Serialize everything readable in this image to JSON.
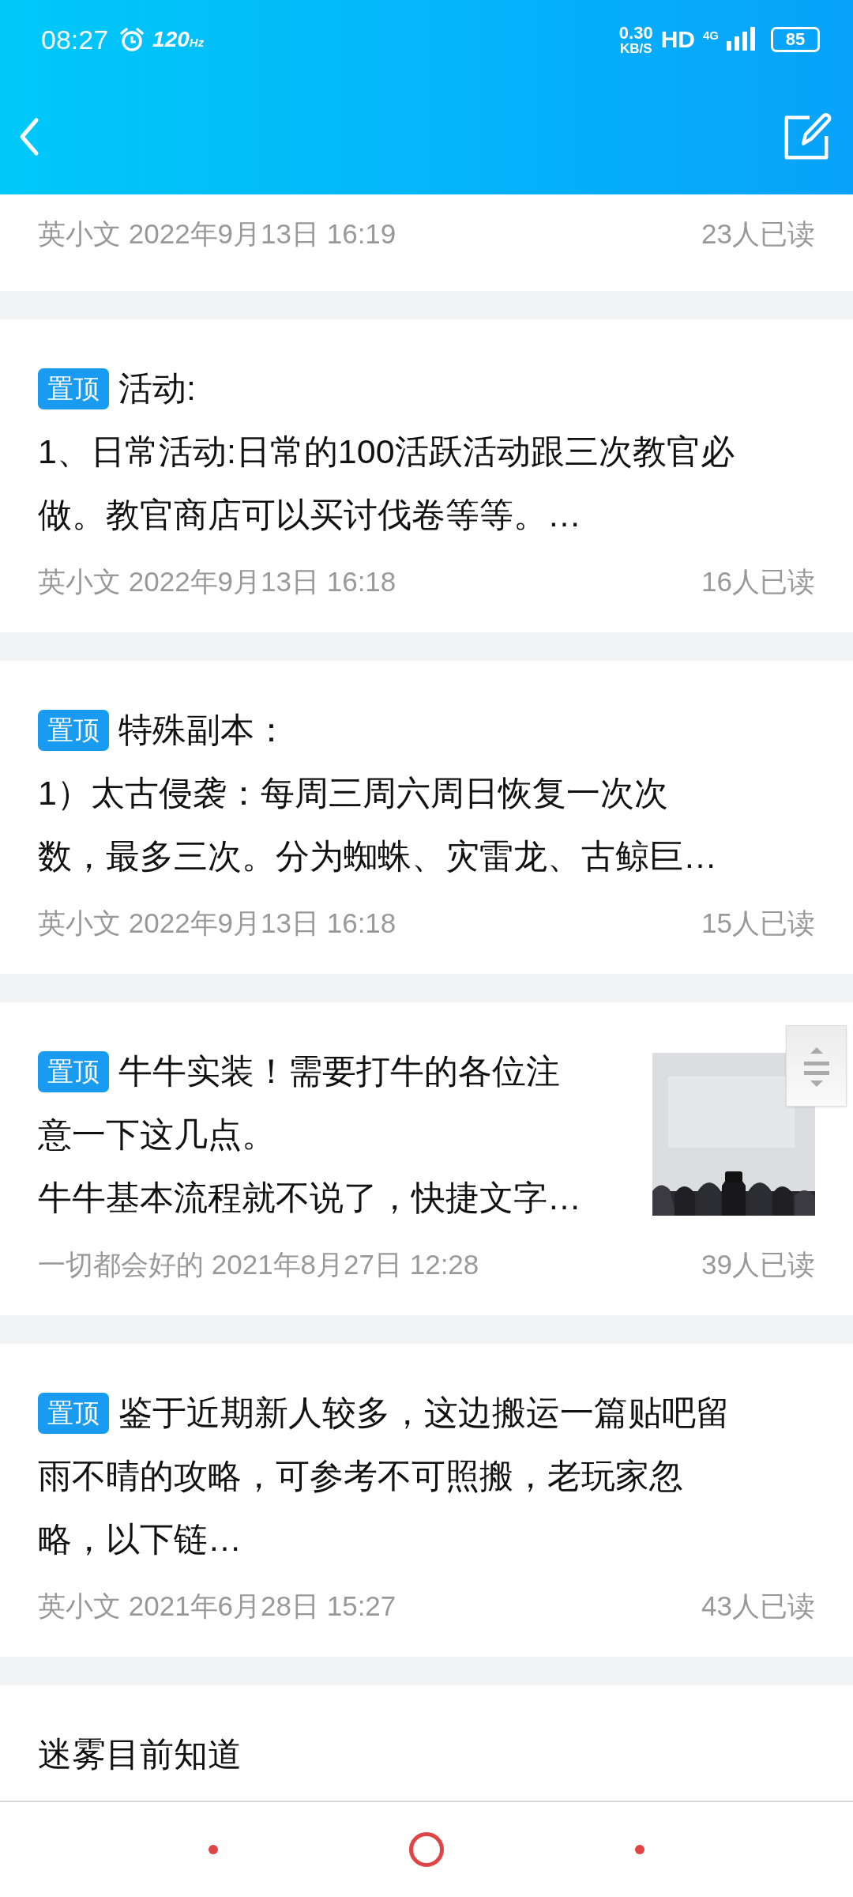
{
  "status_bar": {
    "time": "08:27",
    "refresh_rate": "120",
    "refresh_unit": "Hz",
    "net_speed": "0.30",
    "net_unit": "KB/S",
    "hd": "HD",
    "network": "4G",
    "battery": "85"
  },
  "posts": [
    {
      "pinned": false,
      "author": "英小文",
      "date": "2022年9月13日 16:19",
      "reads": "23人已读"
    },
    {
      "pinned": true,
      "pin_label": "置顶",
      "title_lines": [
        "活动:"
      ],
      "body_lines": [
        "1、日常活动:日常的100活跃活动跟三次教官必",
        "做。教官商店可以买讨伐卷等等。…"
      ],
      "author": "英小文",
      "date": "2022年9月13日 16:18",
      "reads": "16人已读"
    },
    {
      "pinned": true,
      "pin_label": "置顶",
      "title_lines": [
        "特殊副本："
      ],
      "body_lines": [
        "1）太古侵袭：每周三周六周日恢复一次次",
        "数，最多三次。分为蜘蛛、灾雷龙、古鲸巨…"
      ],
      "author": "英小文",
      "date": "2022年9月13日 16:18",
      "reads": "15人已读"
    },
    {
      "pinned": true,
      "pin_label": "置顶",
      "title_lines": [
        "牛牛实装！需要打牛的各位注",
        "意一下这几点。"
      ],
      "body_lines": [
        "牛牛基本流程就不说了，快捷文字…"
      ],
      "thumbnail": {
        "kind": "picture"
      },
      "author": "一切都会好的",
      "date": "2021年8月27日 12:28",
      "reads": "39人已读"
    },
    {
      "pinned": true,
      "pin_label": "置顶",
      "title_lines": [
        "鉴于近期新人较多，这边搬运一篇贴吧留",
        "雨不晴的攻略，可参考不可照搬，老玩家忽",
        "略，以下链…"
      ],
      "author": "英小文",
      "date": "2021年6月28日 15:27",
      "reads": "43人已读"
    },
    {
      "pinned": false,
      "title_lines": [
        "迷雾目前知道"
      ]
    }
  ]
}
